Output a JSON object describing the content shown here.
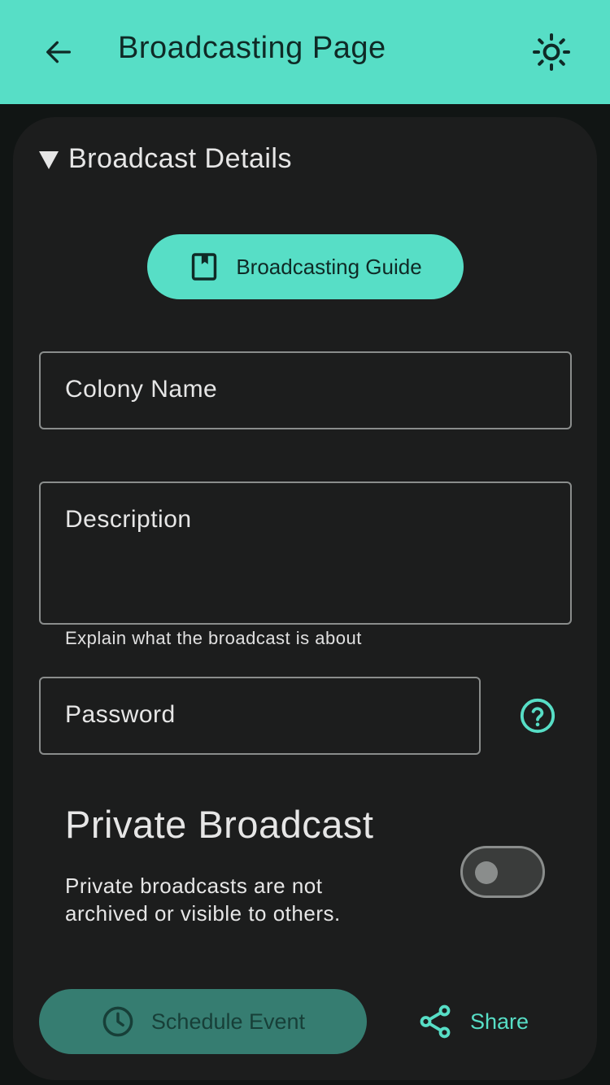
{
  "appbar": {
    "title": "Broadcasting Page",
    "back_icon": "arrow-left-icon",
    "theme_icon": "sun-icon"
  },
  "section": {
    "title": "Broadcast Details",
    "expanded": true
  },
  "guide_button": {
    "label": "Broadcasting Guide",
    "icon": "book-icon"
  },
  "fields": {
    "colony_name": {
      "label": "Colony Name",
      "value": ""
    },
    "description": {
      "label": "Description",
      "value": "",
      "helper": "Explain what the broadcast is about"
    },
    "password": {
      "label": "Password",
      "value": ""
    }
  },
  "private": {
    "title": "Private Broadcast",
    "description": "Private broadcasts are not archived or visible to others.",
    "enabled": false
  },
  "actions": {
    "schedule_label": "Schedule Event",
    "share_label": "Share"
  },
  "colors": {
    "accent": "#57dec6",
    "accent_dark": "#367d71",
    "card": "#1c1d1d",
    "background": "#111514"
  }
}
